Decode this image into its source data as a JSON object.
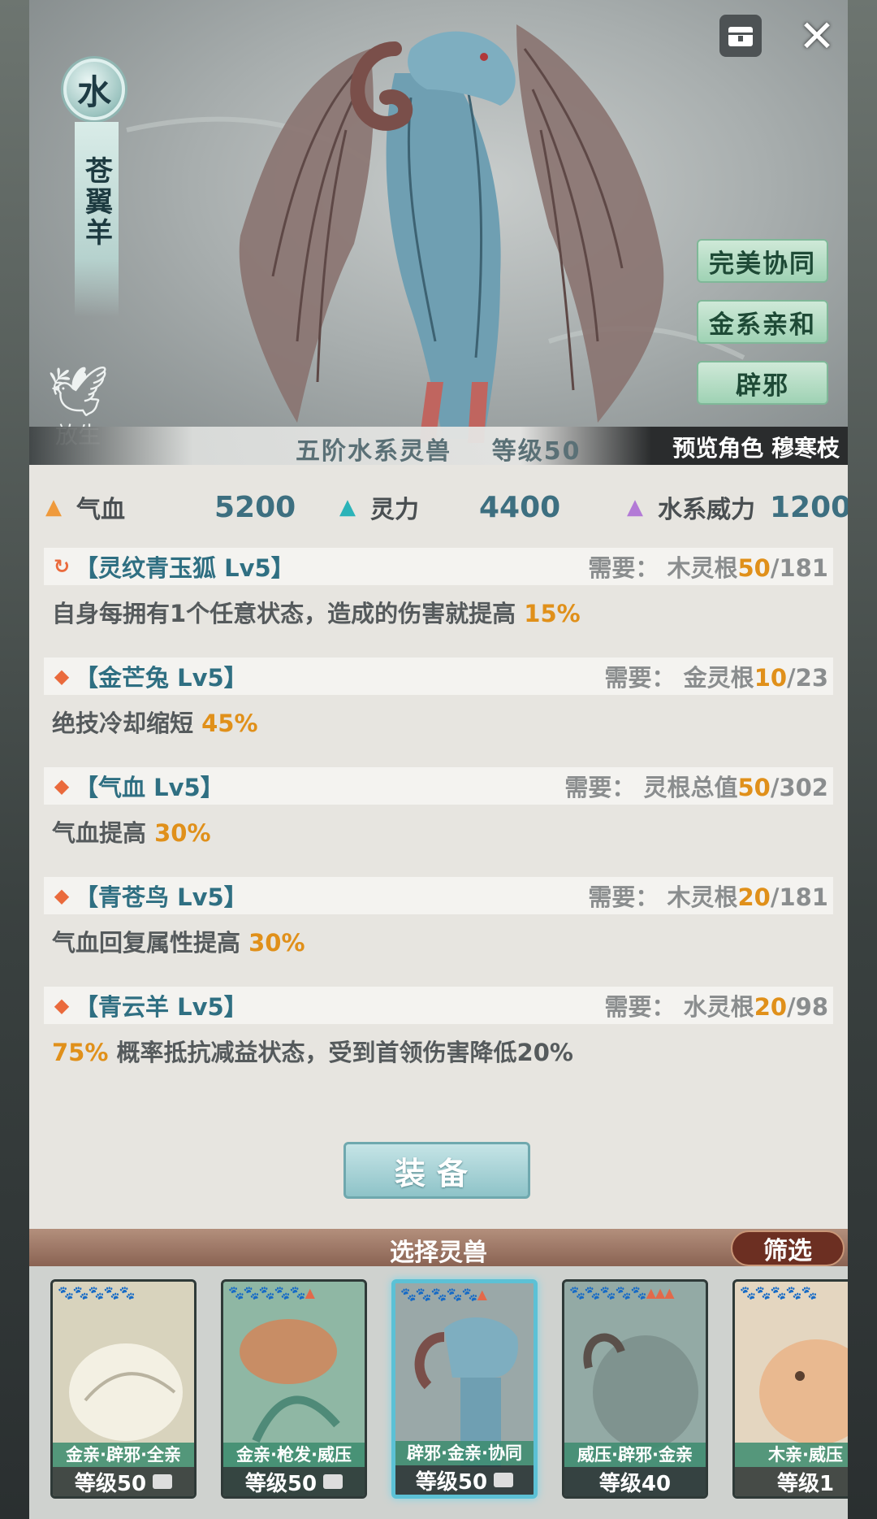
{
  "beast": {
    "element": "水",
    "name": "苍翼羊",
    "tier_line": "五阶水系灵兽",
    "level_label": "等级",
    "level": "50",
    "preview_label": "预览角色 穆寒枝",
    "release_label": "放生"
  },
  "traits": [
    "完美协同",
    "金系亲和",
    "辟邪"
  ],
  "stats": [
    {
      "label": "气血",
      "value": "5200",
      "color": "#ef9a3c"
    },
    {
      "label": "灵力",
      "value": "4400",
      "color": "#2bb3b8"
    },
    {
      "label": "水系威力",
      "value": "1200",
      "color": "#b37ad6"
    }
  ],
  "skills": [
    {
      "icon": "cycle",
      "title": "【灵纹青玉狐 Lv5】",
      "req_label": "需要：",
      "req_name": "木灵根",
      "req_cur": "50",
      "req_max": "/181",
      "desc_pre": "自身每拥有1个任意状态，造成的伤害就提高 ",
      "desc_hl": "15%",
      "desc_post": ""
    },
    {
      "icon": "diamond",
      "title": "【金芒兔 Lv5】",
      "req_label": "需要：",
      "req_name": "金灵根",
      "req_cur": "10",
      "req_max": "/23",
      "desc_pre": "绝技冷却缩短 ",
      "desc_hl": "45%",
      "desc_post": ""
    },
    {
      "icon": "diamond",
      "title": "【气血 Lv5】",
      "req_label": "需要：",
      "req_name": "灵根总值",
      "req_cur": "50",
      "req_max": "/302",
      "desc_pre": "气血提高 ",
      "desc_hl": "30%",
      "desc_post": ""
    },
    {
      "icon": "diamond",
      "title": "【青苍鸟 Lv5】",
      "req_label": "需要：",
      "req_name": "木灵根",
      "req_cur": "20",
      "req_max": "/181",
      "desc_pre": "气血回复属性提高 ",
      "desc_hl": "30%",
      "desc_post": ""
    },
    {
      "icon": "diamond",
      "title": "【青云羊 Lv5】",
      "req_label": "需要：",
      "req_name": "水灵根",
      "req_cur": "20",
      "req_max": "/98",
      "desc_pre": "",
      "desc_hl": "75%",
      "desc_post": " 概率抵抗减益状态，受到首领伤害降低20%"
    }
  ],
  "equip_label": "装备",
  "select_title": "选择灵兽",
  "filter_label": "筛选",
  "cards": [
    {
      "tags": "金亲·辟邪·全亲",
      "level": "等级50",
      "locked": true,
      "selected": false,
      "bg": "#d8d3bd"
    },
    {
      "tags": "金亲·枪发·威压",
      "level": "等级50",
      "locked": true,
      "selected": false,
      "bg": "#8fb7a4"
    },
    {
      "tags": "辟邪·金亲·协同",
      "level": "等级50",
      "locked": true,
      "selected": true,
      "bg": "#9aa8a8"
    },
    {
      "tags": "威压·辟邪·金亲",
      "level": "等级40",
      "locked": false,
      "selected": false,
      "bg": "#93aaa5"
    },
    {
      "tags": "木亲·威压",
      "level": "等级1",
      "locked": false,
      "selected": false,
      "bg": "#e4d6c0"
    }
  ]
}
